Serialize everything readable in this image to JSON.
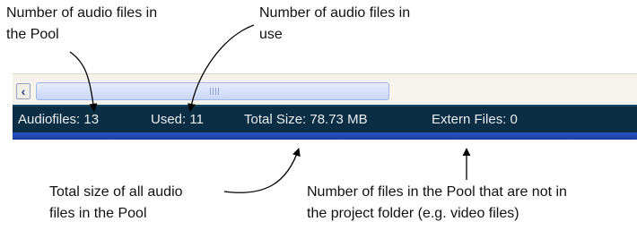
{
  "callouts": {
    "audio_files_in_pool": [
      "Number of audio files in",
      "the Pool"
    ],
    "audio_files_in_use": [
      "Number of audio files in",
      "use"
    ],
    "total_size": [
      "Total size of all audio",
      "files in the Pool"
    ],
    "extern_files": [
      "Number of files in the Pool that are not in",
      "the project folder (e.g. video files)"
    ]
  },
  "statusbar": {
    "audiofiles": "Audiofiles: 13",
    "used": "Used: 11",
    "total_size": "Total Size: 78.73 MB",
    "extern_files": "Extern Files: 0"
  },
  "icons": {
    "scroll_left": "chevron-left-icon"
  },
  "colors": {
    "statusbar_bg": "#0c2e44",
    "statusbar_text": "#e8eef2",
    "bottom_bar": "#2d55c7",
    "scroll_thumb": "#c9d6f5"
  }
}
